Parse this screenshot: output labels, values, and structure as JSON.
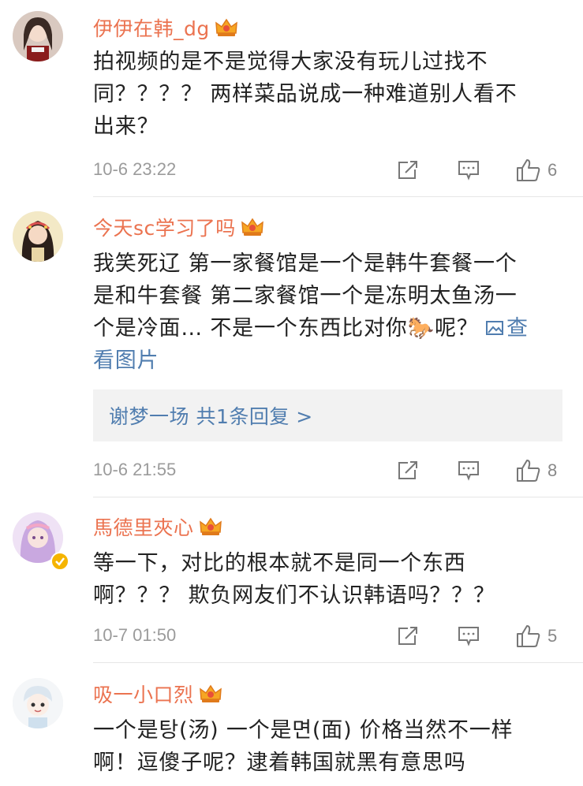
{
  "comments": [
    {
      "username": "伊伊在韩_dg",
      "lines": [
        "拍视频的是不是觉得大家没有玩儿过找不",
        "同？？？？ 两样菜品说成一种难道别人看不",
        "出来？"
      ],
      "time": "10-6 23:22",
      "likes": "6"
    },
    {
      "username": "今天sc学习了吗",
      "lines": [
        "我笑死辽 第一家餐馆是一个是韩牛套餐一个",
        "是和牛套餐 第二家餐馆一个是冻明太鱼汤一",
        "个是冷面… 不是一个东西比对你🐎呢？"
      ],
      "view_image_part1": "查",
      "view_image_part2": "看图片",
      "reply_text": "谢梦一场  共1条回复 >",
      "time": "10-6 21:55",
      "likes": "8"
    },
    {
      "username": "馬德里夾心",
      "lines": [
        "等一下，对比的根本就不是同一个东西",
        "啊？？？ 欺负网友们不认识韩语吗？？？"
      ],
      "time": "10-7 01:50",
      "likes": "5"
    },
    {
      "username": "吸一小口烈",
      "lines": [
        "一个是탕(汤) 一个是면(面) 价格当然不一样",
        "啊！逗傻子呢？逮着韩国就黑有意思吗"
      ]
    }
  ],
  "icons": {
    "share": "share-icon",
    "comment": "comment-icon",
    "like": "like-icon",
    "vip": "crown-icon"
  },
  "colors": {
    "username": "#eb7350",
    "link": "#507daf",
    "meta": "#9b9b9b"
  }
}
